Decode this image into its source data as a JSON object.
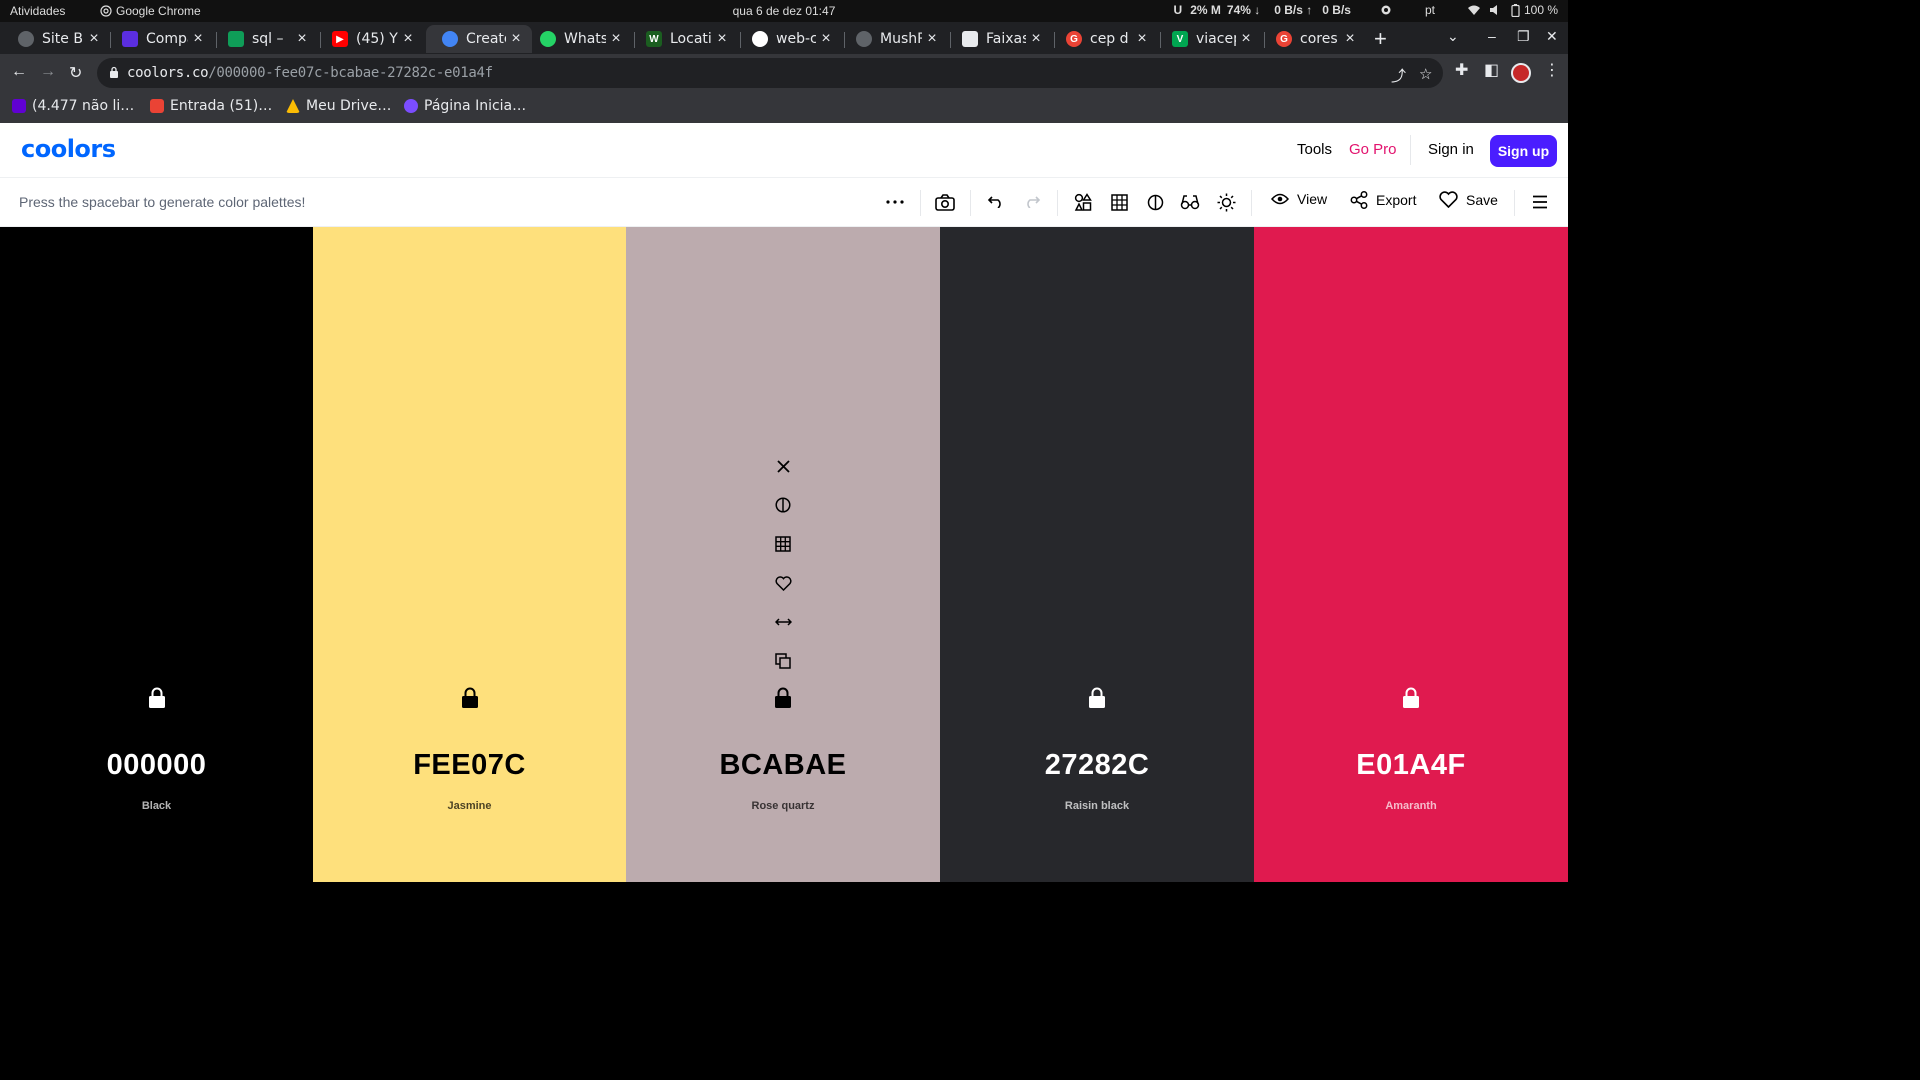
{
  "system_bar": {
    "activities": "Atividades",
    "app_name": "Google Chrome",
    "clock": "qua 6 de dez  01:47",
    "stats": [
      "U",
      "2% M",
      "74% ↓",
      "0 B/s ↑",
      "0 B/s"
    ],
    "language": "pt",
    "battery": "100 %"
  },
  "browser": {
    "tabs": [
      {
        "title": "Site B",
        "favicon_color": "#5f6368"
      },
      {
        "title": "Compa",
        "favicon_color": "#5b2ee0"
      },
      {
        "title": "sql –",
        "favicon_color": "#0f9d58"
      },
      {
        "title": "(45) Y",
        "favicon_color": "#ff0000"
      },
      {
        "title": "Create",
        "favicon_color": "#4285f4"
      },
      {
        "title": "Whats",
        "favicon_color": "#25d366"
      },
      {
        "title": "Locati",
        "favicon_color": "#1b5e20"
      },
      {
        "title": "web-c",
        "favicon_color": "#ffffff"
      },
      {
        "title": "MushR",
        "favicon_color": "#5f6368"
      },
      {
        "title": "Faixas",
        "favicon_color": "#e8eaed"
      },
      {
        "title": "cep d",
        "favicon_color": "#ea4335"
      },
      {
        "title": "viacep",
        "favicon_color": "#00a651"
      },
      {
        "title": "cores",
        "favicon_color": "#ea4335"
      }
    ],
    "active_tab_index": 4,
    "url_host": "coolors.co",
    "url_path": "/000000-fee07c-bcabae-27282c-e01a4f",
    "bookmarks": [
      {
        "label": "(4.477 não li…",
        "color": "#6001d2"
      },
      {
        "label": "Entrada (51)…",
        "color": "#ea4335"
      },
      {
        "label": "Meu Drive…",
        "color": "#fbbc04"
      },
      {
        "label": "Página Inicia…",
        "color": "#7b4dff"
      }
    ]
  },
  "site": {
    "logo": "coolors",
    "nav": {
      "tools": "Tools",
      "go_pro": "Go Pro",
      "sign_in": "Sign in",
      "sign_up": "Sign up"
    },
    "hint": "Press the spacebar to generate color palettes!",
    "toolbar": {
      "view": "View",
      "export": "Export",
      "save": "Save"
    },
    "accent_color": "#4a1dff",
    "pro_color": "#e2136e"
  },
  "palette": [
    {
      "hex": "000000",
      "name": "Black",
      "bg": "#000000",
      "fg": "#ffffff"
    },
    {
      "hex": "FEE07C",
      "name": "Jasmine",
      "bg": "#FEE07C",
      "fg": "#000000"
    },
    {
      "hex": "BCABAE",
      "name": "Rose quartz",
      "bg": "#BCABAE",
      "fg": "#000000"
    },
    {
      "hex": "27282C",
      "name": "Raisin black",
      "bg": "#27282C",
      "fg": "#ffffff"
    },
    {
      "hex": "E01A4F",
      "name": "Amaranth",
      "bg": "#E01A4F",
      "fg": "#ffffff"
    }
  ],
  "hovered_swatch_index": 2
}
